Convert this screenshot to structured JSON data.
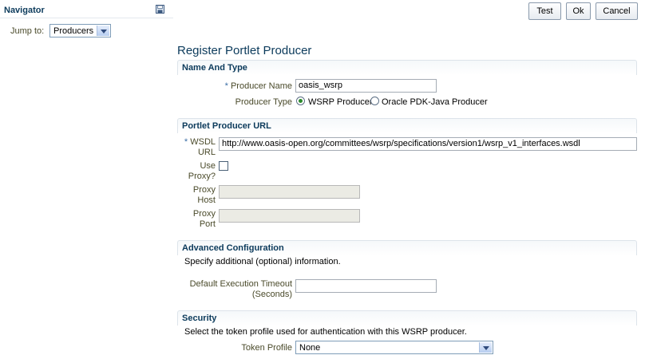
{
  "navigator": {
    "title": "Navigator",
    "jump_to_label": "Jump to:",
    "jump_to_value": "Producers"
  },
  "toolbar": {
    "test_label": "Test",
    "ok_label": "Ok",
    "cancel_label": "Cancel"
  },
  "page": {
    "title": "Register Portlet Producer"
  },
  "name_and_type": {
    "header": "Name And Type",
    "producer_name_label": "Producer Name",
    "producer_name_value": "oasis_wsrp",
    "producer_type_label": "Producer Type",
    "option_wsrp": "WSRP Producer",
    "option_pdk": "Oracle PDK-Java Producer",
    "selected": "WSRP Producer"
  },
  "portlet_url": {
    "header": "Portlet Producer URL",
    "wsdl_label_1": "WSDL",
    "wsdl_label_2": "URL",
    "wsdl_value": "http://www.oasis-open.org/committees/wsrp/specifications/version1/wsrp_v1_interfaces.wsdl",
    "use_proxy_label_1": "Use",
    "use_proxy_label_2": "Proxy?",
    "proxy_host_label_1": "Proxy",
    "proxy_host_label_2": "Host",
    "proxy_port_label_1": "Proxy",
    "proxy_port_label_2": "Port"
  },
  "advanced": {
    "header": "Advanced Configuration",
    "description": "Specify additional (optional) information.",
    "timeout_label_1": "Default Execution Timeout",
    "timeout_label_2": "(Seconds)",
    "timeout_value": ""
  },
  "security": {
    "header": "Security",
    "description": "Select the token profile used for authentication with this WSRP producer.",
    "token_profile_label": "Token Profile",
    "token_profile_value": "None"
  },
  "colors": {
    "header_text": "#0b3a5b",
    "label_text": "#4a4a2a",
    "required_star": "#3a6ea5"
  }
}
